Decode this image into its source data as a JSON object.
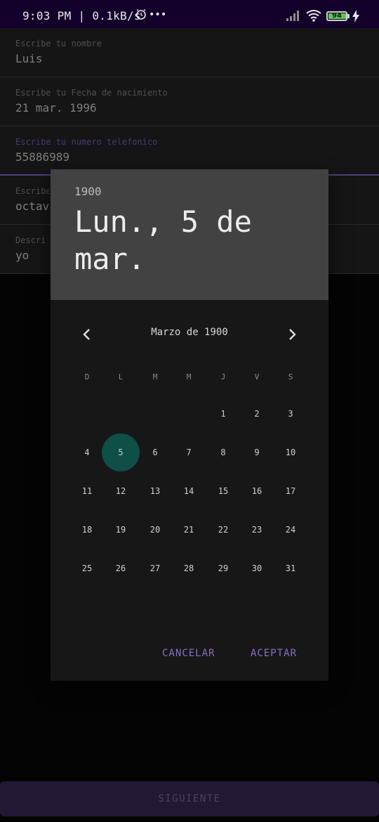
{
  "status_bar": {
    "time": "9:03 PM | 0.1kB/s",
    "more": "•••",
    "battery": "94",
    "icons": [
      "alarm-icon",
      "signal-icon",
      "wifi-icon",
      "battery-icon",
      "charging-icon"
    ]
  },
  "form": {
    "fields": [
      {
        "label": "Escribe tu nombre",
        "value": "Luis"
      },
      {
        "label": "Escribe tu Fecha de nacimiento",
        "value": "21 mar. 1996"
      },
      {
        "label": "Escribe tu numero telefonico",
        "value": "55886989"
      },
      {
        "label": "Escribe",
        "value": "octav"
      },
      {
        "label": "Descri",
        "value": "yo"
      }
    ],
    "next_button": "SIGUIENTE"
  },
  "date_picker": {
    "year": "1900",
    "selected_date": "Lun., 5 de mar.",
    "month_title": "Marzo de 1900",
    "weekdays": [
      "D",
      "L",
      "M",
      "M",
      "J",
      "V",
      "S"
    ],
    "first_weekday_index": 4,
    "days_in_month": 31,
    "selected_day": 5,
    "cancel_label": "CANCELAR",
    "accept_label": "ACEPTAR",
    "colors": {
      "accent": "#8a6fc4",
      "selected_circle": "#0e4f48",
      "header_bg": "#424242"
    }
  }
}
